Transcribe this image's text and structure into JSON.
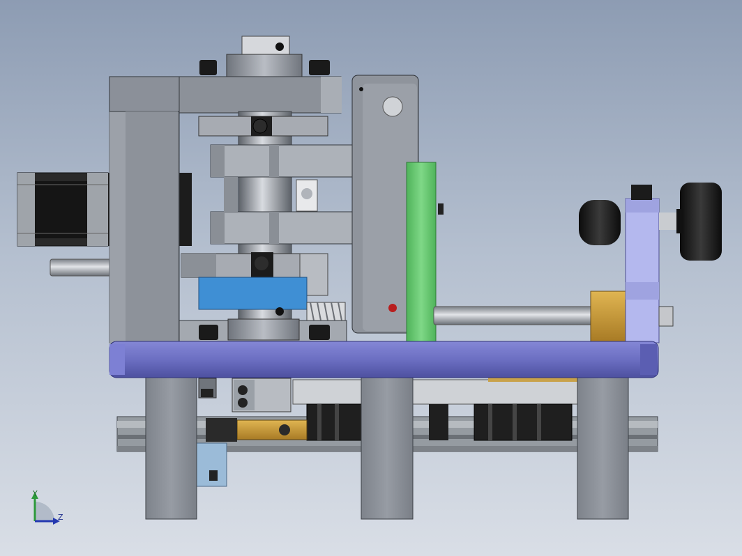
{
  "viewport": {
    "background_top": "#8d9cb3",
    "background_bottom": "#d9dee6"
  },
  "model": {
    "base_plate_color": "#6f72c4",
    "frame_color": "#8e939c",
    "bracket_green": "#62c46b",
    "block_blue": "#3d8fd6",
    "brass_color": "#c79a3b",
    "rail_color": "#8f959a",
    "motor_color": "#1e1e1e",
    "knob_color": "#151515"
  },
  "triad": {
    "y_label": "Y",
    "z_label": "Z",
    "y_axis_color": "#2c9a3a",
    "z_axis_color": "#2438b0"
  }
}
